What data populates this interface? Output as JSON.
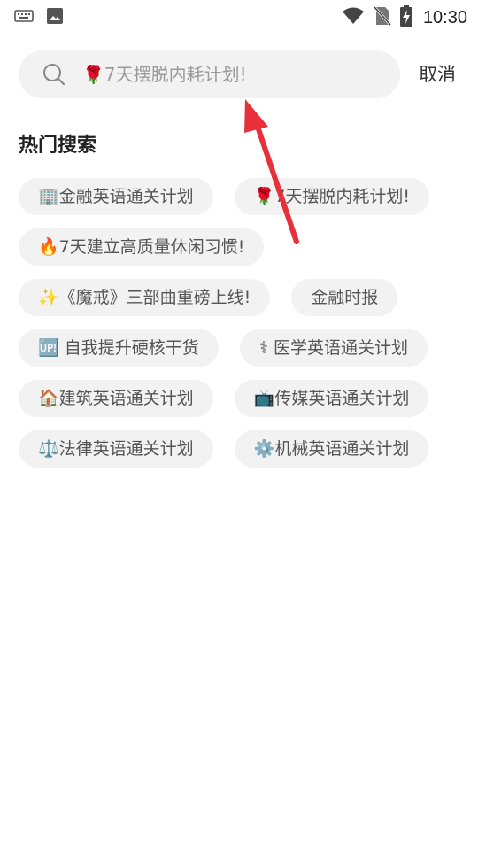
{
  "status_bar": {
    "time": "10:30",
    "icons": [
      "keyboard-icon",
      "image-icon",
      "wifi-icon",
      "no-sim-icon",
      "battery-charging-icon"
    ]
  },
  "search": {
    "placeholder": "🌹7天摆脱内耗计划!",
    "cancel_label": "取消"
  },
  "hot_search": {
    "title": "热门搜索",
    "rows": [
      [
        {
          "label": "🏢金融英语通关计划"
        },
        {
          "label": "🌹7天摆脱内耗计划!"
        }
      ],
      [
        {
          "label": "🔥7天建立高质量休闲习惯!"
        }
      ],
      [
        {
          "label": "✨《魔戒》三部曲重磅上线!"
        },
        {
          "label": "金融时报"
        }
      ],
      [
        {
          "label": "🆙 自我提升硬核干货"
        },
        {
          "label": "⚕ 医学英语通关计划"
        }
      ],
      [
        {
          "label": "🏠建筑英语通关计划"
        },
        {
          "label": "📺传媒英语通关计划"
        }
      ],
      [
        {
          "label": "⚖️法律英语通关计划"
        },
        {
          "label": "⚙️机械英语通关计划"
        }
      ]
    ]
  },
  "colors": {
    "arrow": "#e8303a",
    "pill_bg": "#f2f2f2",
    "pill_text": "#555555"
  }
}
